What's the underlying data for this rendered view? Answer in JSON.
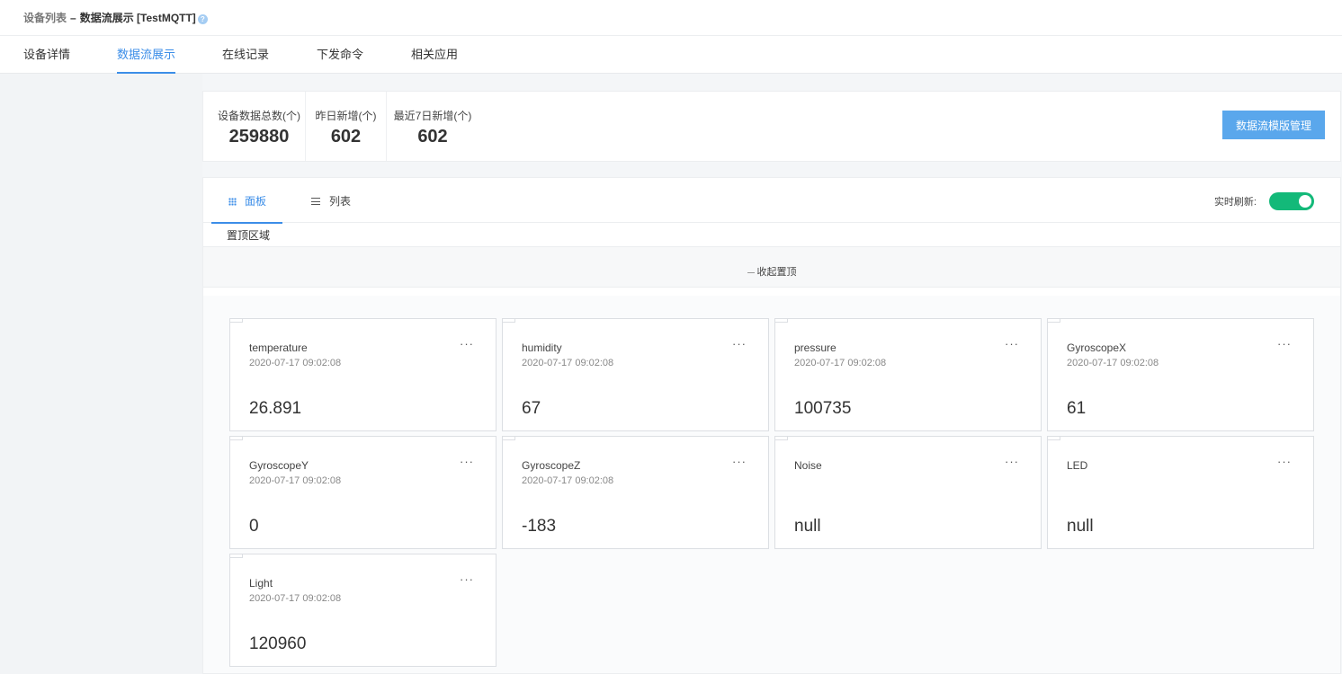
{
  "breadcrumb": {
    "parent": "设备列表",
    "separator": "–",
    "current": "数据流展示 [TestMQTT]",
    "help_glyph": "?"
  },
  "tabs": [
    {
      "label": "设备详情",
      "active": false
    },
    {
      "label": "数据流展示",
      "active": true
    },
    {
      "label": "在线记录",
      "active": false
    },
    {
      "label": "下发命令",
      "active": false
    },
    {
      "label": "相关应用",
      "active": false
    }
  ],
  "stats": [
    {
      "label": "设备数据总数(个)",
      "value": "259880"
    },
    {
      "label": "昨日新增(个)",
      "value": "602"
    },
    {
      "label": "最近7日新增(个)",
      "value": "602"
    }
  ],
  "template_button": "数据流模版管理",
  "view_tabs": [
    {
      "label": "面板",
      "icon": "grid-icon",
      "active": true
    },
    {
      "label": "列表",
      "icon": "list-icon",
      "active": false
    }
  ],
  "realtime_refresh": {
    "label": "实时刷新:",
    "enabled": true
  },
  "pin_area_label": "置顶区域",
  "collapse_label": "收起置顶",
  "cards": [
    {
      "name": "temperature",
      "time": "2020-07-17 09:02:08",
      "value": "26.891"
    },
    {
      "name": "humidity",
      "time": "2020-07-17 09:02:08",
      "value": "67"
    },
    {
      "name": "pressure",
      "time": "2020-07-17 09:02:08",
      "value": "100735"
    },
    {
      "name": "GyroscopeX",
      "time": "2020-07-17 09:02:08",
      "value": "61"
    },
    {
      "name": "GyroscopeY",
      "time": "2020-07-17 09:02:08",
      "value": "0"
    },
    {
      "name": "GyroscopeZ",
      "time": "2020-07-17 09:02:08",
      "value": "-183"
    },
    {
      "name": "Noise",
      "time": "",
      "value": "null"
    },
    {
      "name": "LED",
      "time": "",
      "value": "null"
    },
    {
      "name": "Light",
      "time": "2020-07-17 09:02:08",
      "value": "120960"
    }
  ],
  "card_more_glyph": "···",
  "colors": {
    "accent": "#3c8ee8",
    "button": "#5aa7ec",
    "toggle_on": "#13b979"
  }
}
